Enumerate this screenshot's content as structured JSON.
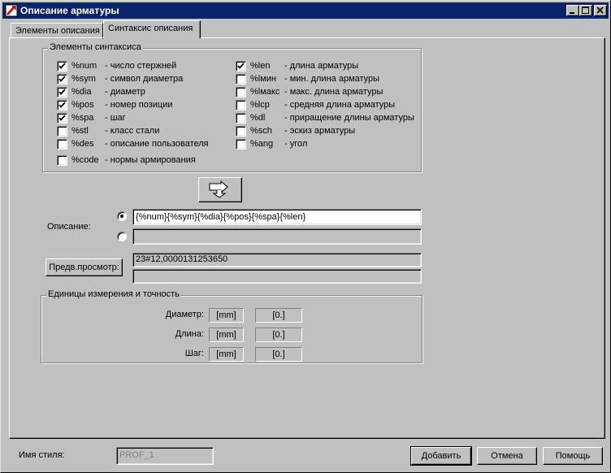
{
  "window": {
    "title": "Описание арматуры",
    "controls": {
      "minimize": "minimize-icon",
      "maximize": "maximize-icon",
      "close": "close-icon"
    }
  },
  "tabs": [
    {
      "label": "Элементы описания",
      "active": false
    },
    {
      "label": "Синтаксис описания",
      "active": true
    }
  ],
  "syntax": {
    "group_label": "Элементы синтаксиса",
    "left_items": [
      {
        "code": "%num",
        "desc": "- число стержней",
        "checked": true
      },
      {
        "code": "%sym",
        "desc": "- символ диаметра",
        "checked": true
      },
      {
        "code": "%dia",
        "desc": "- диаметр",
        "checked": true
      },
      {
        "code": "%pos",
        "desc": "- номер позиции",
        "checked": true
      },
      {
        "code": "%spa",
        "desc": "- шаг",
        "checked": true
      },
      {
        "code": "%stl",
        "desc": "- класс стали",
        "checked": false
      },
      {
        "code": "%des",
        "desc": "- описание пользователя",
        "checked": false
      },
      {
        "code": "%code",
        "desc": "- нормы армирования",
        "checked": false
      }
    ],
    "right_items": [
      {
        "code": "%len",
        "desc": "- длина арматуры",
        "checked": true
      },
      {
        "code": "%lмин",
        "desc": "- мин. длина арматуры",
        "checked": false
      },
      {
        "code": "%lмакс",
        "desc": "- макс. длина арматуры",
        "checked": false
      },
      {
        "code": "%lcp",
        "desc": "- средняя длина арматуры",
        "checked": false
      },
      {
        "code": "%dl",
        "desc": "- приращение длины арматуры",
        "checked": false
      },
      {
        "code": "%sch",
        "desc": "- эскиз арматуры",
        "checked": false
      },
      {
        "code": "%ang",
        "desc": "- угол",
        "checked": false
      }
    ]
  },
  "insert_button_icon": "insert-arrow-icon",
  "description": {
    "label": "Описание:",
    "line1": "{%num}{%sym}{%dia}{%pos}{%spa}{%len}",
    "line2": "",
    "selected": 1
  },
  "preview": {
    "button_label": "Предв.просмотр:",
    "line1": "23#12,0000131253650",
    "line2": ""
  },
  "units": {
    "group_label": "Единицы измерения и точность",
    "rows": [
      {
        "label": "Диаметр:",
        "unit": "[mm]",
        "precision": "[0.]"
      },
      {
        "label": "Длина:",
        "unit": "[mm]",
        "precision": "[0.]"
      },
      {
        "label": "Шаг:",
        "unit": "[mm]",
        "precision": "[0.]"
      }
    ]
  },
  "style": {
    "label": "Имя стиля:",
    "value": "PROF_1"
  },
  "buttons": {
    "add": "Добавить",
    "cancel": "Отмена",
    "help": "Помощь"
  }
}
